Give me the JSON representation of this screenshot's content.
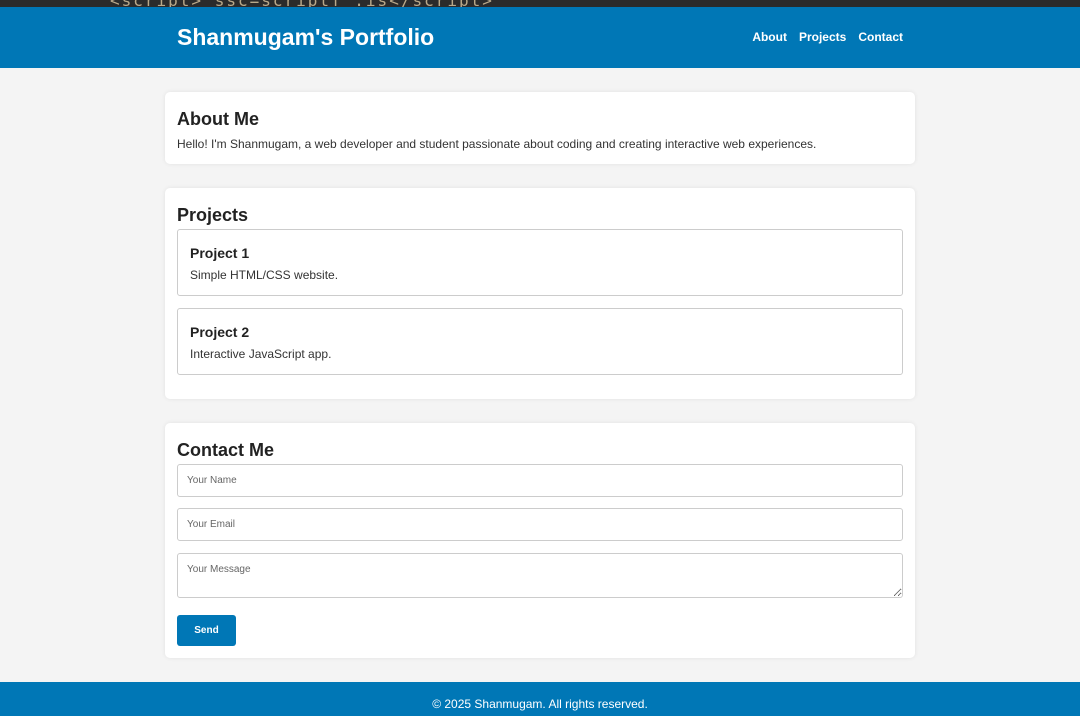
{
  "header": {
    "title": "Shanmugam's Portfolio",
    "nav": [
      "About",
      "Projects",
      "Contact"
    ]
  },
  "about": {
    "heading": "About Me",
    "text": "Hello! I'm Shanmugam, a web developer and student passionate about coding and creating interactive web experiences."
  },
  "projects": {
    "heading": "Projects",
    "items": [
      {
        "title": "Project 1",
        "description": "Simple HTML/CSS website."
      },
      {
        "title": "Project 2",
        "description": "Interactive JavaScript app."
      }
    ]
  },
  "contact": {
    "heading": "Contact Me",
    "name_placeholder": "Your Name",
    "email_placeholder": "Your Email",
    "message_placeholder": "Your Message",
    "send_label": "Send"
  },
  "footer": {
    "text": "© 2025 Shanmugam. All rights reserved."
  },
  "colors": {
    "brand": "#0077b6",
    "background": "#f4f4f4",
    "card": "#ffffff"
  }
}
